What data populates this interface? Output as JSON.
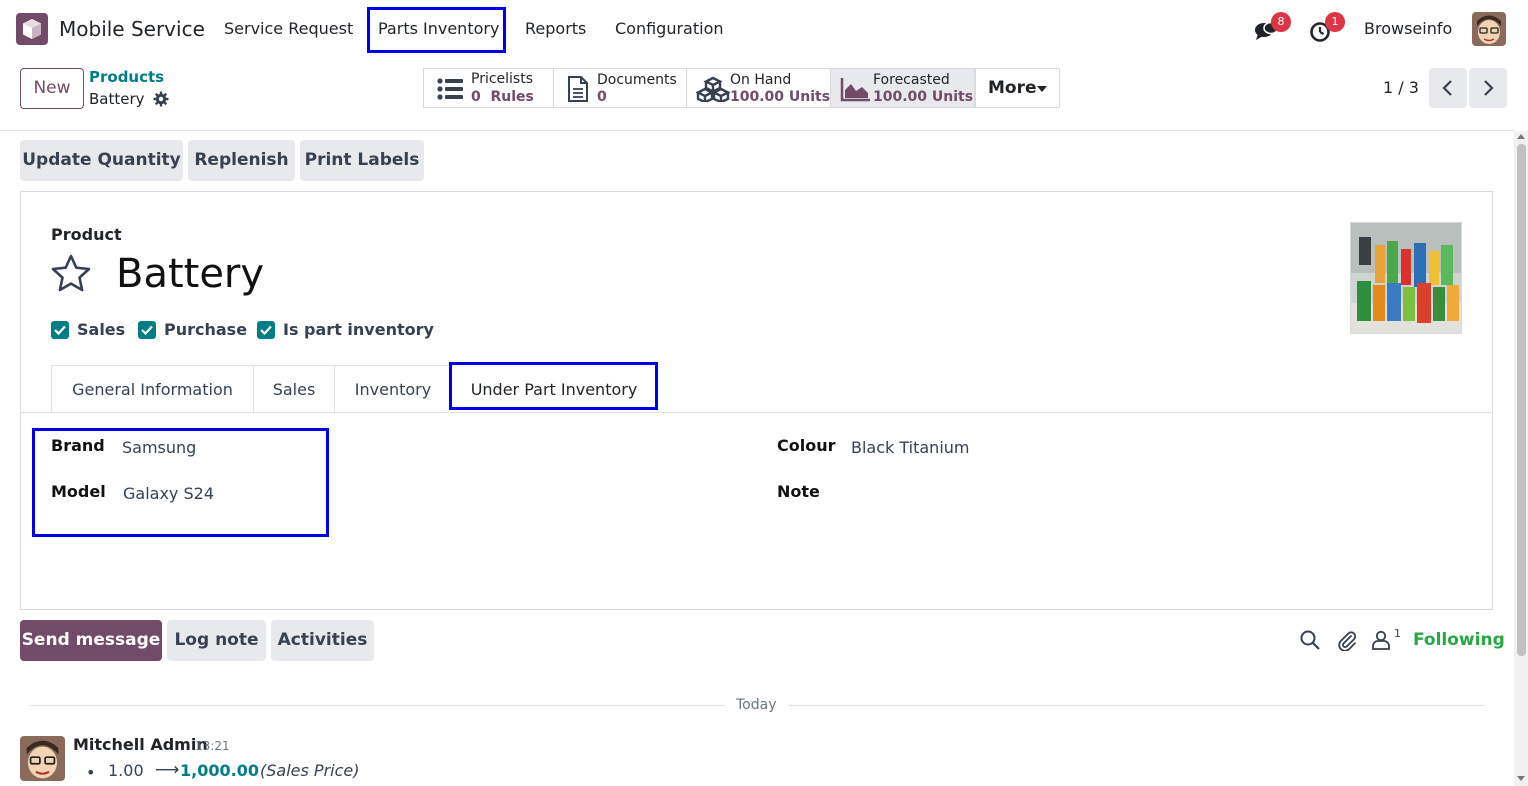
{
  "navbar": {
    "app_name": "Mobile Service",
    "menu": [
      "Service Request",
      "Parts Inventory",
      "Reports",
      "Configuration"
    ],
    "highlighted_menu": "Parts Inventory",
    "messages_badge": "8",
    "activities_badge": "1",
    "user_name": "Browseinfo",
    "icons": [
      "app-logo-icon",
      "chat-icon",
      "clock-icon",
      "avatar"
    ]
  },
  "control_panel": {
    "new_label": "New",
    "breadcrumb_parent": "Products",
    "breadcrumb_current": "Battery",
    "smart_buttons": [
      {
        "title": "Pricelists",
        "value": "0  Rules",
        "icon": "list-icon"
      },
      {
        "title": "Documents",
        "value": "0",
        "icon": "document-icon"
      },
      {
        "title": "On Hand",
        "value": "100.00 Units",
        "icon": "cubes-icon"
      },
      {
        "title": "Forecasted",
        "value": "100.00 Units",
        "icon": "area-chart-icon"
      }
    ],
    "more_label": "More",
    "pager": "1 / 3"
  },
  "actions": [
    "Update Quantity",
    "Replenish",
    "Print Labels"
  ],
  "form": {
    "product_label": "Product",
    "product_name": "Battery",
    "checkboxes": [
      {
        "label": "Sales",
        "checked": true
      },
      {
        "label": "Purchase",
        "checked": true
      },
      {
        "label": "Is part inventory",
        "checked": true
      }
    ],
    "tabs": [
      "General Information",
      "Sales",
      "Inventory",
      "Under Part Inventory"
    ],
    "active_tab": "Under Part Inventory",
    "fields_left": [
      {
        "label": "Brand",
        "value": "Samsung"
      },
      {
        "label": "Model",
        "value": "Galaxy S24"
      }
    ],
    "fields_right": [
      {
        "label": "Colour",
        "value": "Black Titanium"
      },
      {
        "label": "Note",
        "value": ""
      }
    ]
  },
  "chatter": {
    "send_message": "Send message",
    "log_note": "Log note",
    "activities": "Activities",
    "followers_count": "1",
    "following": "Following",
    "date_separator": "Today",
    "message": {
      "author": "Mitchell Admin",
      "time": "13:21",
      "old_value": "1.00",
      "arrow": "⟶",
      "new_value": "1,000.00",
      "field": "(Sales Price)"
    }
  },
  "colors": {
    "brand": "#714b67",
    "teal": "#017e84",
    "highlight": "#0000e6",
    "badge": "#dc3545",
    "following": "#28a745"
  }
}
